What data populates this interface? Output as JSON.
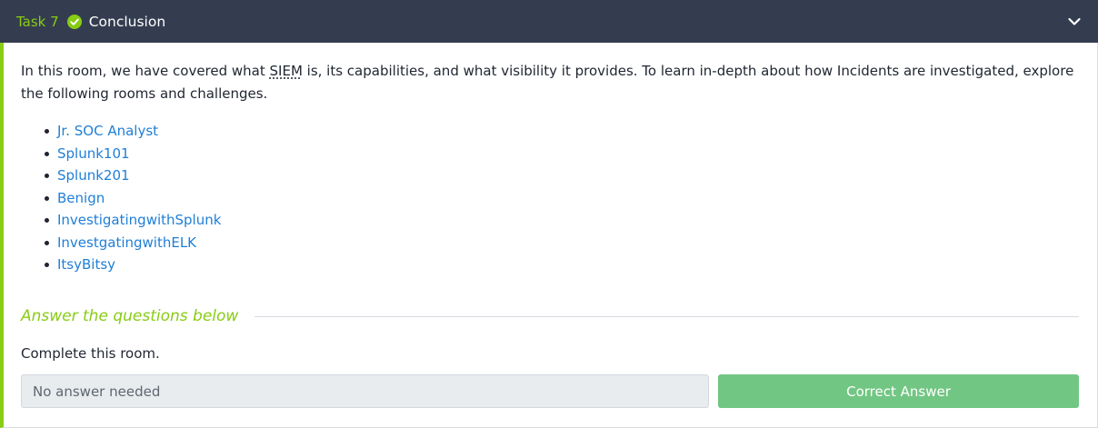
{
  "task": {
    "number_label": "Task 7",
    "title": "Conclusion",
    "status_icon": "check-circle-icon",
    "expand_icon": "chevron-down-icon",
    "accent_color": "#88cc14",
    "header_bg": "#343d50"
  },
  "body": {
    "intro_before": "In this room, we have covered what ",
    "intro_abbr": "SIEM",
    "intro_after": " is, its capabilities, and what visibility it provides. To learn in-depth about how Incidents are investigated, explore the following rooms and challenges.",
    "rooms": [
      "Jr. SOC Analyst",
      "Splunk101",
      "Splunk201",
      "Benign",
      "InvestigatingwithSplunk",
      "InvestgatingwithELK",
      "ItsyBitsy"
    ],
    "link_color": "#1f7fd6"
  },
  "answers": {
    "heading": "Answer the questions below",
    "question": "Complete this room.",
    "input_value": "No answer needed",
    "button_label": "Correct Answer",
    "button_color": "#72c683"
  }
}
